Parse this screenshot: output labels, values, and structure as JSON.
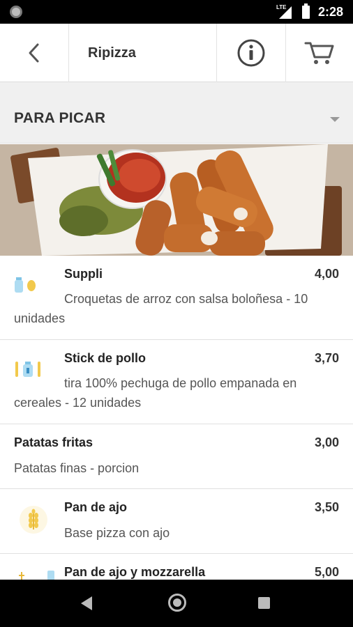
{
  "status_bar": {
    "network": "LTE",
    "time": "2:28"
  },
  "toolbar": {
    "title": "Ripizza",
    "back_icon": "back-arrow-icon",
    "info_icon": "info-icon",
    "cart_icon": "cart-icon"
  },
  "section": {
    "title": "PARA PICAR",
    "caret_icon": "dropdown-caret-icon"
  },
  "items": [
    {
      "name": "Suppli",
      "price": "4,00",
      "description": "Croquetas de arroz con salsa boloñesa - 10 unidades",
      "icons": [
        "milk-bottle-icon",
        "egg-icon"
      ]
    },
    {
      "name": "Stick de pollo",
      "price": "3,70",
      "description": "tira 100% pechuga de pollo empanada en cereales - 12 unidades",
      "icons": [
        "wheat-icon",
        "milk-bottle-icon",
        "egg-icon"
      ]
    },
    {
      "name": "Patatas fritas",
      "price": "3,00",
      "description": "Patatas finas - porcion",
      "icons": []
    },
    {
      "name": "Pan de ajo",
      "price": "3,50",
      "description": "Base pizza con ajo",
      "icons": [
        "wheat-icon"
      ]
    },
    {
      "name": "Pan de ajo y mozzarella",
      "price": "5,00",
      "description": "",
      "icons": [
        "wheat-icon",
        "milk-bottle-icon"
      ]
    }
  ],
  "colors": {
    "allergen_blue": "#7fc4e6",
    "allergen_yellow": "#f2c94c",
    "header_bg": "#f0f0f0"
  }
}
